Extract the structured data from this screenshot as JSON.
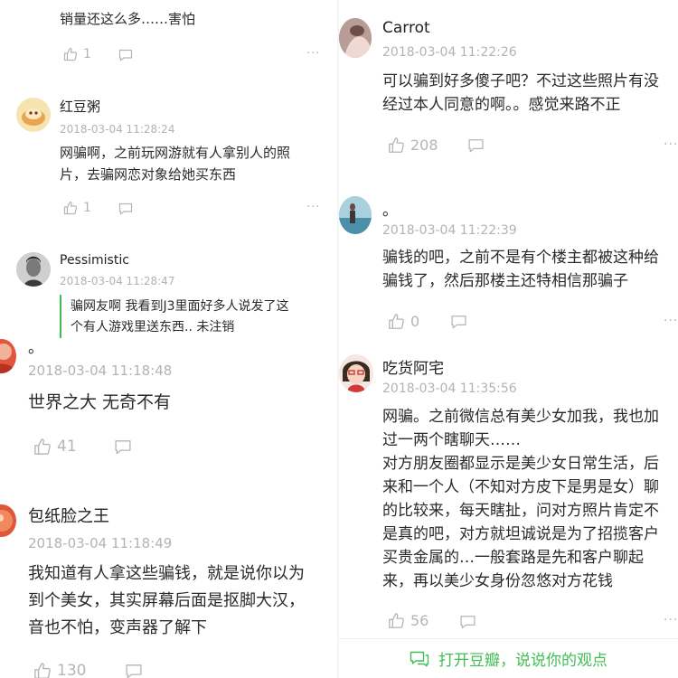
{
  "left": {
    "c0": {
      "text": "销量还这么多……害怕",
      "likes": "1"
    },
    "c1": {
      "name": "红豆粥",
      "time": "2018-03-04 11:28:24",
      "text": "网骗啊，之前玩网游就有人拿别人的照\n片，去骗网恋对象给她买东西",
      "likes": "1"
    },
    "c2": {
      "name": "Pessimistic",
      "time": "2018-03-04 11:28:47",
      "text": "骗网友啊 我看到J3里面好多人说发了这\n个有人游戏里送东西.. 未注销"
    },
    "c3": {
      "name": "。",
      "time": "2018-03-04 11:18:48",
      "text": "世界之大 无奇不有",
      "likes": "41"
    },
    "c4": {
      "name": "包纸脸之王",
      "time": "2018-03-04 11:18:49",
      "text": "我知道有人拿这些骗钱，就是说你以为\n到个美女，其实屏幕后面是抠脚大汉，\n音也不怕，变声器了解下",
      "likes": "130"
    }
  },
  "right": {
    "c0": {
      "name": "Carrot",
      "time": "2018-03-04 11:22:26",
      "text": "可以骗到好多傻子吧？不过这些照片有没\n经过本人同意的啊。。感觉来路不正",
      "likes": "208"
    },
    "c1": {
      "name": "。",
      "time": "2018-03-04 11:22:39",
      "text": "骗钱的吧，之前不是有个楼主都被这种给\n骗钱了，然后那楼主还特相信那骗子",
      "likes": "0"
    },
    "c2": {
      "name": "吃货阿宅",
      "time": "2018-03-04 11:35:56",
      "text": "网骗。之前微信总有美少女加我，我也加\n过一两个瞎聊天……\n对方朋友圈都显示是美少女日常生活，后\n来和一个人（不知对方皮下是男是女）聊\n的比较来，每天瞎扯，问对方照片肯定不\n是真的吧，对方就坦诚说是为了招揽客户\n买贵金属的…一般套路是先和客户聊起\n来，再以美少女身份忽悠对方花钱",
      "likes": "56"
    }
  },
  "more_glyph": "···",
  "cta": {
    "label": "打开豆瓣，说说你的观点"
  },
  "colors": {
    "accent": "#42bd56",
    "meta": "#b3b3b3",
    "text": "#2a2a2a"
  }
}
